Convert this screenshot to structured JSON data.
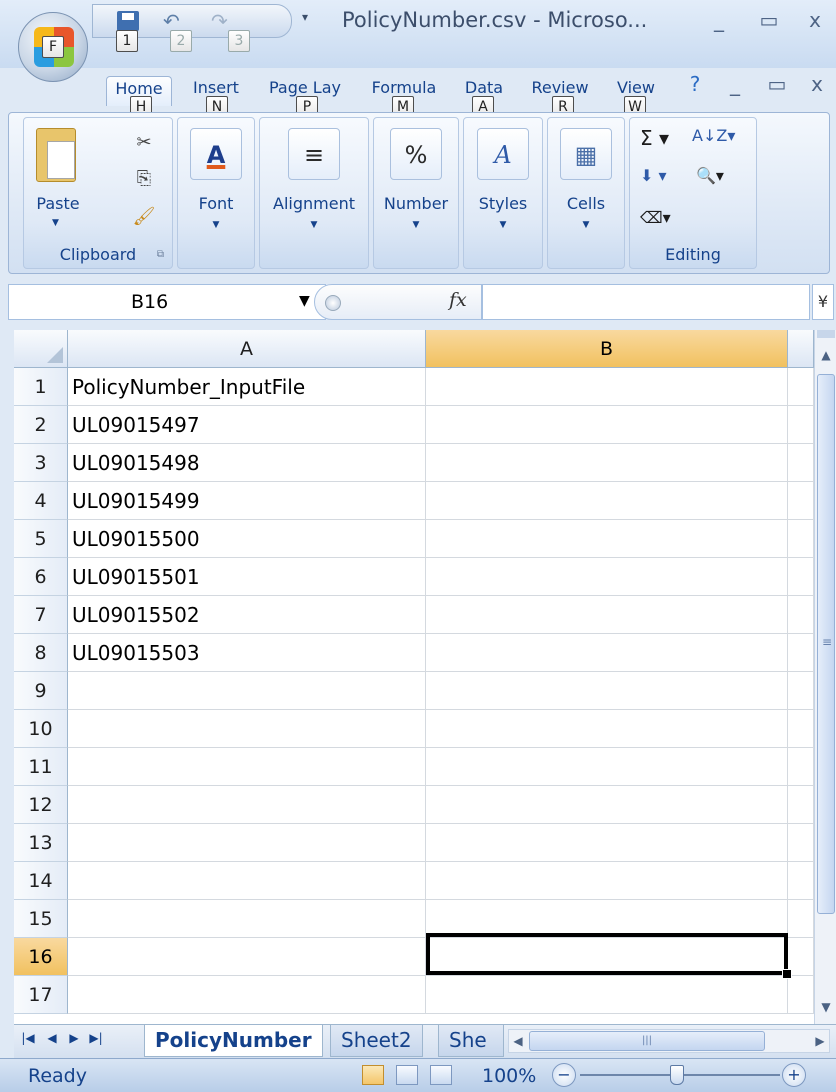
{
  "window": {
    "title": "PolicyNumber.csv - Microso...",
    "controls": [
      "_",
      "▭",
      "x"
    ],
    "ribbon_controls": [
      "?",
      "_",
      "▭",
      "x"
    ]
  },
  "office_button": {
    "keytip": "F"
  },
  "quick_access": {
    "keytips": [
      "1",
      "2",
      "3"
    ],
    "dropdown": "▾"
  },
  "tabs": [
    {
      "label": "Home",
      "keytip": "H"
    },
    {
      "label": "Insert",
      "keytip": "N"
    },
    {
      "label": "Page Lay",
      "keytip": "P"
    },
    {
      "label": "Formula",
      "keytip": "M"
    },
    {
      "label": "Data",
      "keytip": "A"
    },
    {
      "label": "Review",
      "keytip": "R"
    },
    {
      "label": "View",
      "keytip": "W"
    }
  ],
  "ribbon": {
    "clipboard": {
      "paste": "Paste",
      "label": "Clipboard"
    },
    "font": {
      "label": "Font",
      "icon": "A"
    },
    "alignment": {
      "label": "Alignment",
      "icon": "≡"
    },
    "number": {
      "label": "Number",
      "icon": "%"
    },
    "styles": {
      "label": "Styles",
      "icon": "A"
    },
    "cells": {
      "label": "Cells",
      "icon": "▦"
    },
    "editing": {
      "label": "Editing",
      "sum": "Σ ▾",
      "sort": "A↓Z▾",
      "fill": "⬇ ▾",
      "find": "🔍▾",
      "clear": "⌫▾"
    }
  },
  "formula_bar": {
    "name_box": "B16",
    "fx": "fx",
    "value": "",
    "expand": "¥"
  },
  "grid": {
    "columns": [
      "A",
      "B"
    ],
    "selected_column": "B",
    "rows": [
      "1",
      "2",
      "3",
      "4",
      "5",
      "6",
      "7",
      "8",
      "9",
      "10",
      "11",
      "12",
      "13",
      "14",
      "15",
      "16",
      "17"
    ],
    "selected_row": "16",
    "cells_A": [
      "PolicyNumber_InputFile",
      "UL09015497",
      "UL09015498",
      "UL09015499",
      "UL09015500",
      "UL09015501",
      "UL09015502",
      "UL09015503",
      "",
      "",
      "",
      "",
      "",
      "",
      "",
      "",
      ""
    ],
    "active_cell": "B16"
  },
  "sheets": {
    "tabs": [
      "PolicyNumber",
      "Sheet2",
      "She"
    ],
    "active": "PolicyNumber",
    "nav": [
      "|◀",
      "◀",
      "▶",
      "▶|"
    ]
  },
  "status": {
    "text": "Ready",
    "zoom": "100%",
    "zoom_level_percent": 100
  },
  "colors": {
    "accent": "#15428b",
    "selection_header": "#f1c15f",
    "ribbon_bg": "#dfe9f6"
  }
}
